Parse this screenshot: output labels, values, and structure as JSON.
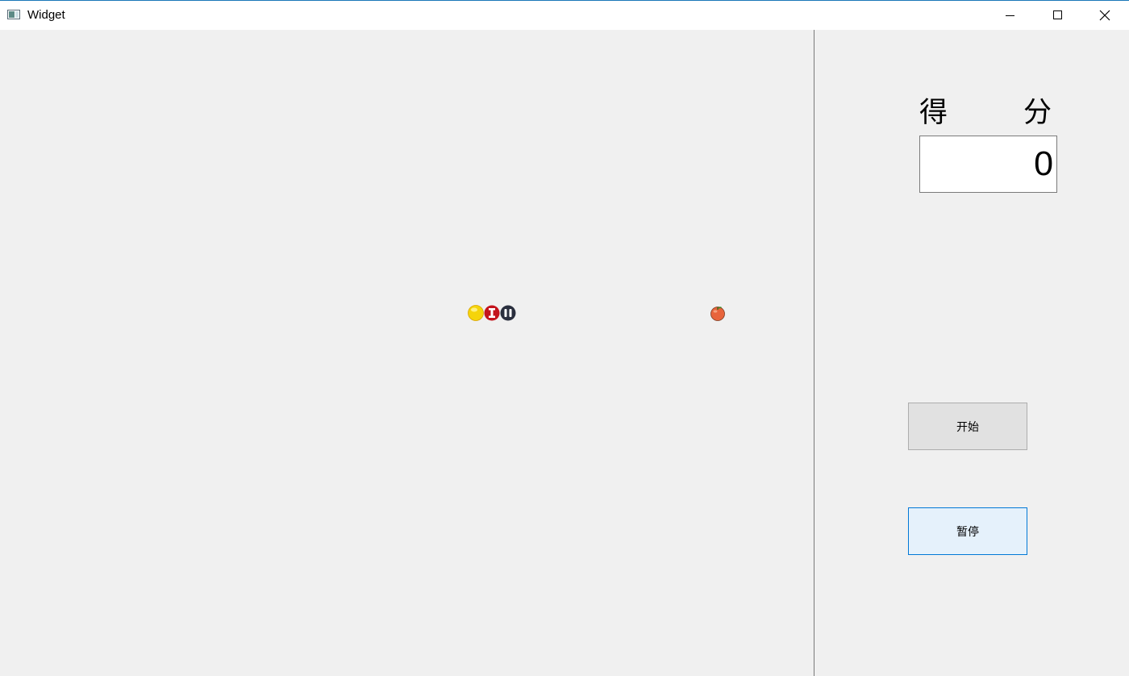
{
  "window": {
    "title": "Widget",
    "icon": "app-window-icon",
    "controls": [
      "minimize-icon",
      "maximize-icon",
      "close-icon"
    ]
  },
  "game": {
    "snake_segments": [
      {
        "type": "head",
        "color": "#f5d40a",
        "icon": "snake-head-icon"
      },
      {
        "type": "body",
        "color": "#c4141d",
        "icon": "snake-body-icon"
      },
      {
        "type": "tail",
        "color": "#2a2f3e",
        "icon": "snake-tail-icon"
      }
    ],
    "food": {
      "type": "apple",
      "color": "#e8643c",
      "icon": "apple-icon"
    }
  },
  "sidebar": {
    "score_label_chars": [
      "得",
      "分"
    ],
    "score_value": "0",
    "start_button_label": "开始",
    "pause_button_label": "暂停"
  },
  "colors": {
    "background": "#f0f0f0",
    "pause_focus_border": "#0078d7",
    "pause_focus_fill": "#e5f1fb"
  }
}
